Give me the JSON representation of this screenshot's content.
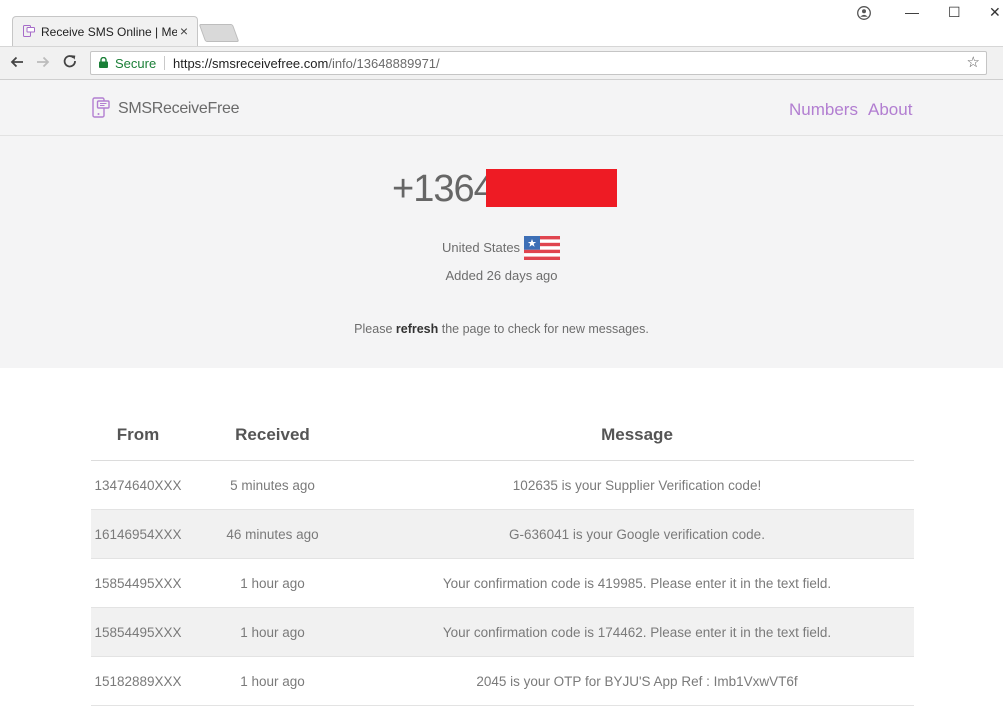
{
  "browser": {
    "tab_title": "Receive SMS Online | Me",
    "tab_close": "×",
    "secure_label": "Secure",
    "url_host": "https://smsreceivefree.com",
    "url_path": "/info/13648889971/",
    "star_icon": "☆",
    "minimize": "—",
    "maximize": "☐",
    "close": "✕"
  },
  "site": {
    "logo_text": "SMSReceiveFree",
    "nav": {
      "numbers": "Numbers",
      "about": "About"
    },
    "accent_color": "#b27ed1"
  },
  "hero": {
    "phone_prefix": "+1364",
    "country": "United States",
    "added": "Added 26 days ago",
    "refresh_pre": "Please ",
    "refresh_bold": "refresh",
    "refresh_post": " the page to check for new messages."
  },
  "table": {
    "headers": {
      "from": "From",
      "received": "Received",
      "message": "Message"
    },
    "rows": [
      {
        "from": "13474640XXX",
        "received": "5 minutes ago",
        "message": "102635 is your Supplier Verification code!"
      },
      {
        "from": "16146954XXX",
        "received": "46 minutes ago",
        "message": "G-636041 is your Google verification code."
      },
      {
        "from": "15854495XXX",
        "received": "1 hour ago",
        "message": "Your confirmation code is 419985. Please enter it in the text field."
      },
      {
        "from": "15854495XXX",
        "received": "1 hour ago",
        "message": "Your confirmation code is 174462. Please enter it in the text field."
      },
      {
        "from": "15182889XXX",
        "received": "1 hour ago",
        "message": "2045 is your OTP for BYJU'S App Ref : Imb1VxwVT6f"
      }
    ]
  }
}
